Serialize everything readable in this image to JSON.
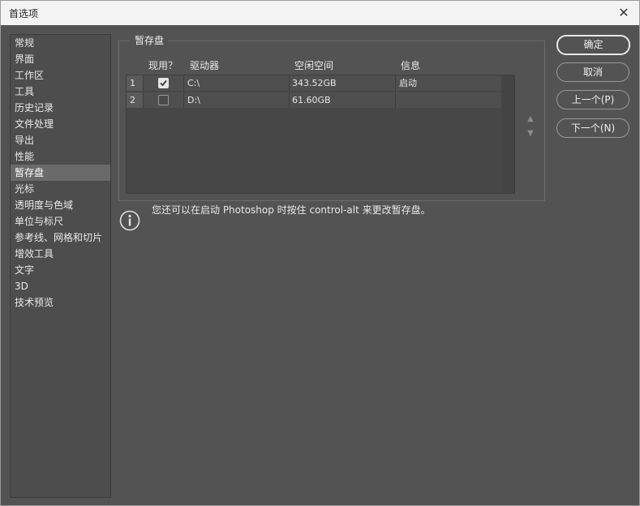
{
  "window": {
    "title": "首选项"
  },
  "sidebar": {
    "items": [
      {
        "label": "常规"
      },
      {
        "label": "界面"
      },
      {
        "label": "工作区"
      },
      {
        "label": "工具"
      },
      {
        "label": "历史记录"
      },
      {
        "label": "文件处理"
      },
      {
        "label": "导出"
      },
      {
        "label": "性能"
      },
      {
        "label": "暂存盘",
        "selected": true
      },
      {
        "label": "光标"
      },
      {
        "label": "透明度与色域"
      },
      {
        "label": "单位与标尺"
      },
      {
        "label": "参考线、网格和切片"
      },
      {
        "label": "增效工具"
      },
      {
        "label": "文字"
      },
      {
        "label": "3D"
      },
      {
        "label": "技术预览"
      }
    ]
  },
  "scratch": {
    "group_title": "暂存盘",
    "columns": {
      "active": "现用？",
      "drive": "驱动器",
      "free": "空闲空间",
      "info": "信息"
    },
    "rows": [
      {
        "num": "1",
        "checked": true,
        "drive": "C:\\",
        "free": "343.52GB",
        "info": "启动"
      },
      {
        "num": "2",
        "checked": false,
        "drive": "D:\\",
        "free": "61.60GB",
        "info": ""
      }
    ],
    "note": "您还可以在启动 Photoshop 时按住 control-alt 来更改暂存盘。"
  },
  "buttons": {
    "ok": "确定",
    "cancel": "取消",
    "prev": "上一个(P)",
    "next": "下一个(N)"
  },
  "icons": {
    "close": "close-icon",
    "info": "info-icon",
    "up": "arrow-up-icon",
    "down": "arrow-down-icon",
    "check": "checkmark-icon"
  }
}
